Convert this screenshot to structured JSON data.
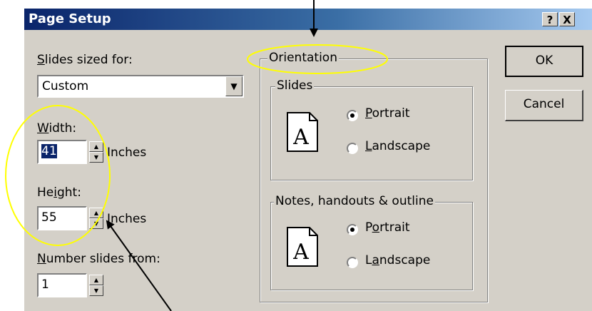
{
  "dialog": {
    "title": "Page Setup",
    "help_label": "?",
    "close_label": "X"
  },
  "left": {
    "slides_sized_for": {
      "accel": "S",
      "rest": "lides sized for:",
      "value": "Custom"
    },
    "width": {
      "accel": "W",
      "rest": "idth:",
      "value": "41",
      "unit": "Inches"
    },
    "height": {
      "pre": "He",
      "accel": "i",
      "post": "ght:",
      "value": "55",
      "unit": "Inches"
    },
    "number_from": {
      "accel": "N",
      "rest": "umber slides from:",
      "value": "1"
    }
  },
  "orientation": {
    "title": "Orientation",
    "slides": {
      "title": "Slides",
      "icon_glyph": "A",
      "portrait": {
        "accel": "P",
        "rest": "ortrait",
        "selected": true
      },
      "landscape": {
        "accel": "L",
        "rest": "andscape",
        "selected": false
      }
    },
    "notes": {
      "title": "Notes, handouts & outline",
      "icon_glyph": "A",
      "portrait": {
        "pre": "P",
        "accel": "o",
        "post": "rtrait",
        "selected": true
      },
      "landscape": {
        "pre": "L",
        "accel": "a",
        "post": "ndscape",
        "selected": false
      }
    }
  },
  "buttons": {
    "ok": "OK",
    "cancel": "Cancel"
  },
  "annotations": {
    "highlight_color": "#ffff00"
  }
}
